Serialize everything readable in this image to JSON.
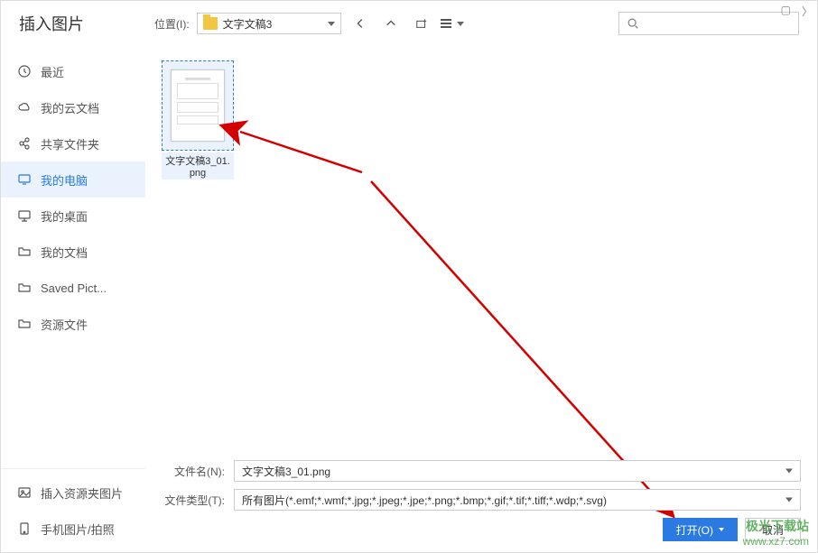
{
  "title": "插入图片",
  "location": {
    "label": "位置(I):",
    "folder_name": "文字文稿3"
  },
  "sidebar": {
    "items": [
      {
        "label": "最近",
        "icon": "clock-icon"
      },
      {
        "label": "我的云文档",
        "icon": "cloud-icon"
      },
      {
        "label": "共享文件夹",
        "icon": "share-icon"
      },
      {
        "label": "我的电脑",
        "icon": "monitor-icon",
        "active": true
      },
      {
        "label": "我的桌面",
        "icon": "desktop-icon"
      },
      {
        "label": "我的文档",
        "icon": "folder-icon"
      },
      {
        "label": "Saved Pict...",
        "icon": "folder-icon"
      },
      {
        "label": "资源文件",
        "icon": "folder-icon"
      }
    ],
    "bottom": [
      {
        "label": "插入资源夹图片",
        "icon": "image-insert-icon"
      },
      {
        "label": "手机图片/拍照",
        "icon": "phone-icon"
      }
    ]
  },
  "files": [
    {
      "name": "文字文稿3_01.png",
      "selected": true
    }
  ],
  "form": {
    "filename_label": "文件名(N):",
    "filename_value": "文字文稿3_01.png",
    "filetype_label": "文件类型(T):",
    "filetype_value": "所有图片(*.emf;*.wmf;*.jpg;*.jpeg;*.jpe;*.png;*.bmp;*.gif;*.tif;*.tiff;*.wdp;*.svg)"
  },
  "buttons": {
    "open": "打开(O)",
    "cancel": "取消"
  },
  "watermark": {
    "line1": "极光下载站",
    "line2": "www.xz7.com"
  }
}
